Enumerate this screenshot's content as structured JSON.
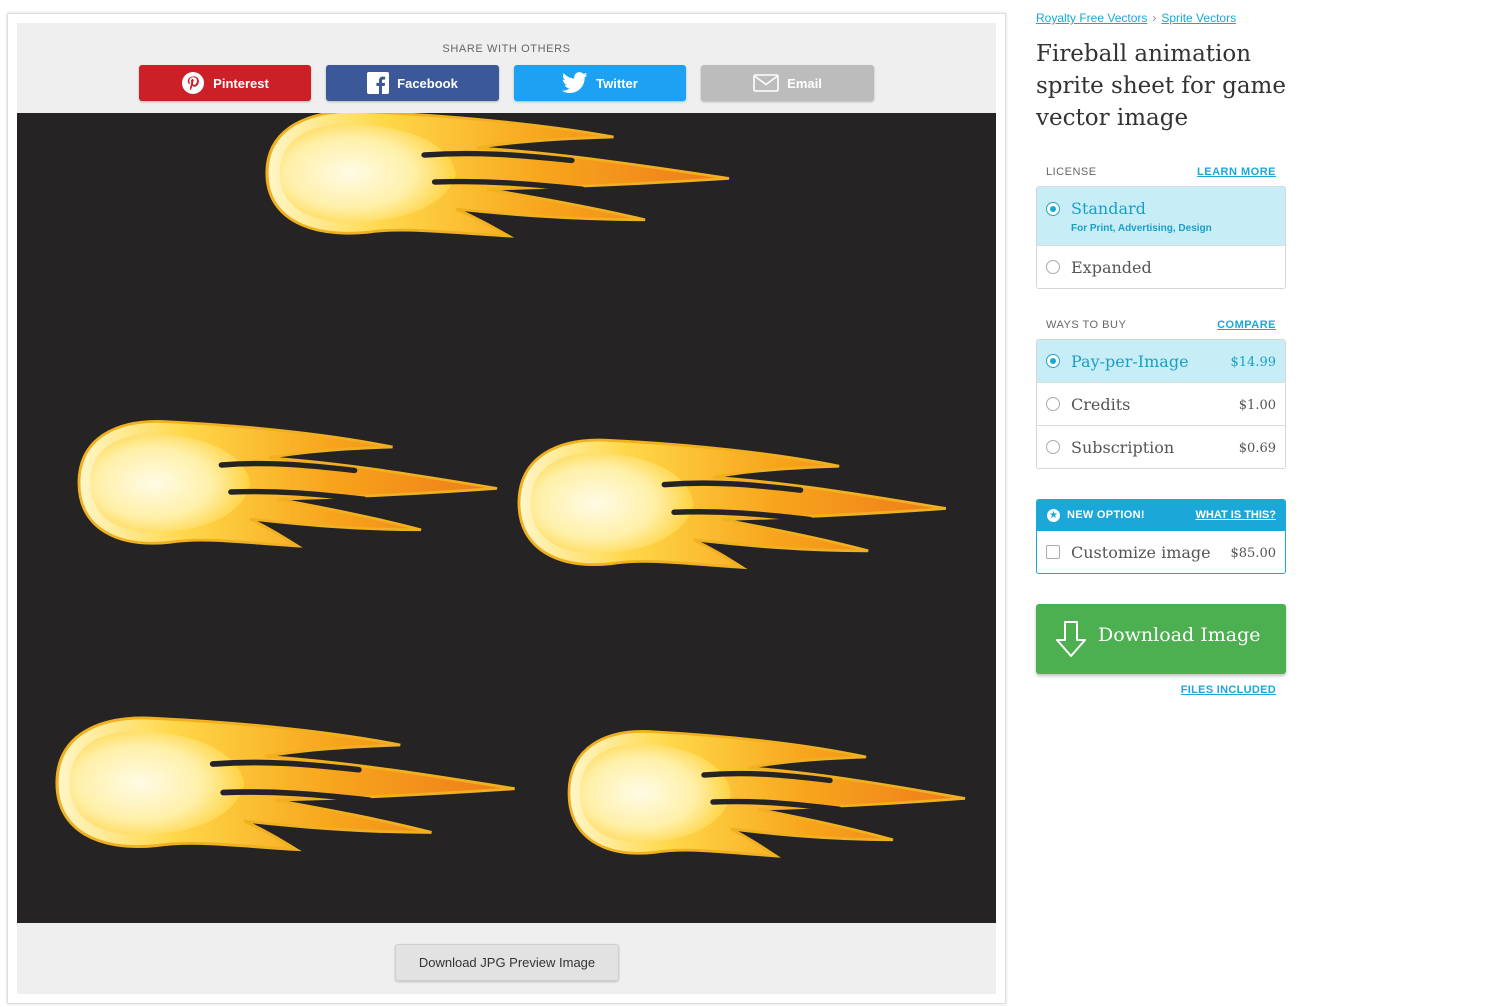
{
  "share": {
    "title": "SHARE WITH OTHERS",
    "pinterest": "Pinterest",
    "facebook": "Facebook",
    "twitter": "Twitter",
    "email": "Email"
  },
  "preview": {
    "download_jpg": "Download JPG Preview Image"
  },
  "breadcrumb": {
    "item1": "Royalty Free Vectors",
    "item2": "Sprite Vectors"
  },
  "product": {
    "title": "Fireball animation sprite sheet for game vector image"
  },
  "license": {
    "heading": "LICENSE",
    "link": "LEARN MORE",
    "options": [
      {
        "label": "Standard",
        "sub": "For Print, Advertising, Design",
        "selected": true
      },
      {
        "label": "Expanded",
        "selected": false
      }
    ]
  },
  "buy": {
    "heading": "WAYS TO BUY",
    "link": "COMPARE",
    "options": [
      {
        "label": "Pay-per-Image",
        "price": "$14.99",
        "selected": true
      },
      {
        "label": "Credits",
        "price": "$1.00",
        "selected": false
      },
      {
        "label": "Subscription",
        "price": "$0.69",
        "selected": false
      }
    ]
  },
  "new_option": {
    "heading": "NEW OPTION!",
    "link": "WHAT IS THIS?",
    "label": "Customize image",
    "price": "$85.00"
  },
  "download": {
    "label": "Download Image",
    "files_link": "FILES INCLUDED"
  },
  "colors": {
    "accent": "#1ba7d8",
    "download": "#4caf50",
    "pinterest": "#cb2027",
    "facebook": "#3b5998",
    "twitter": "#1da1f2",
    "preview_bg": "#252324"
  }
}
